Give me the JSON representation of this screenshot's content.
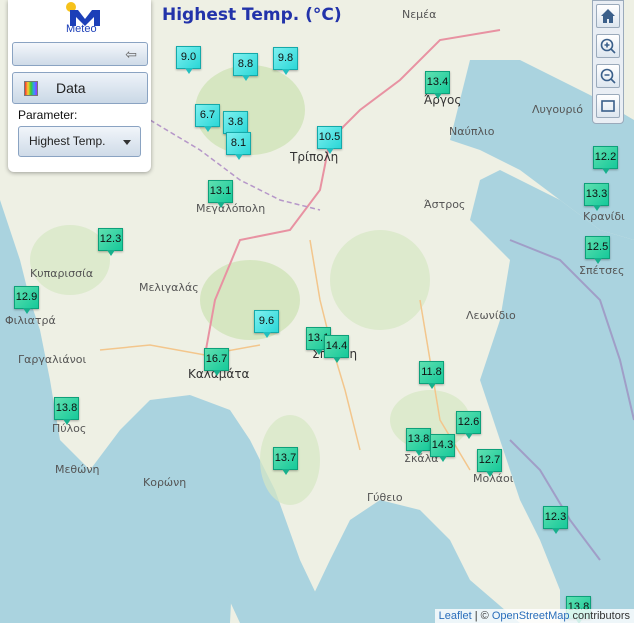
{
  "title": "Highest Temp. (°C)",
  "panel": {
    "logo_text": "Meteo",
    "data_button_label": "Data",
    "parameter_label": "Parameter:",
    "parameter_value": "Highest Temp."
  },
  "zoom_controls": {
    "home_icon": "home-icon",
    "zoom_in_icon": "zoom-in-icon",
    "zoom_out_icon": "zoom-out-icon",
    "fullscreen_icon": "fullscreen-icon"
  },
  "stations": [
    {
      "value": "9.0",
      "color": "cool"
    },
    {
      "value": "8.8",
      "color": "cool"
    },
    {
      "value": "9.8",
      "color": "cool"
    },
    {
      "value": "13.4",
      "color": "warm"
    },
    {
      "value": "6.7",
      "color": "cool"
    },
    {
      "value": "3.8",
      "color": "cool"
    },
    {
      "value": "8.1",
      "color": "cool"
    },
    {
      "value": "10.5",
      "color": "cool"
    },
    {
      "value": "12.2",
      "color": "warm"
    },
    {
      "value": "13.1",
      "color": "warm"
    },
    {
      "value": "13.3",
      "color": "warm"
    },
    {
      "value": "12.3",
      "color": "warm"
    },
    {
      "value": "12.5",
      "color": "warm"
    },
    {
      "value": "12.9",
      "color": "warm"
    },
    {
      "value": "9.6",
      "color": "cool"
    },
    {
      "value": "13.1",
      "color": "warm"
    },
    {
      "value": "14.4",
      "color": "warm"
    },
    {
      "value": "16.7",
      "color": "warm"
    },
    {
      "value": "11.8",
      "color": "warm"
    },
    {
      "value": "13.8",
      "color": "warm"
    },
    {
      "value": "12.6",
      "color": "warm"
    },
    {
      "value": "13.8",
      "color": "warm"
    },
    {
      "value": "14.3",
      "color": "warm"
    },
    {
      "value": "12.7",
      "color": "warm"
    },
    {
      "value": "13.7",
      "color": "warm"
    },
    {
      "value": "12.3",
      "color": "warm"
    },
    {
      "value": "13.8",
      "color": "warm"
    }
  ],
  "places": [
    "Νεμέα",
    "Άργος",
    "Λυγουριό",
    "Ναύπλιο",
    "Τρίπολη",
    "Μεγαλόπολη",
    "Άστρος",
    "Κρανίδι",
    "Σπέτσες",
    "Κυπαρισσία",
    "Μελιγαλάς",
    "Φιλιατρά",
    "Λεωνίδιο",
    "Γαργαλιάνοι",
    "Καλαμάτα",
    "Σπάρτη",
    "Πύλος",
    "Μεθώνη",
    "Κορώνη",
    "Σκάλα",
    "Μολάοι",
    "Γύθειο"
  ],
  "attribution": {
    "leaflet": "Leaflet",
    "separator": " | © ",
    "osm": "OpenStreetMap",
    "suffix": " contributors"
  }
}
